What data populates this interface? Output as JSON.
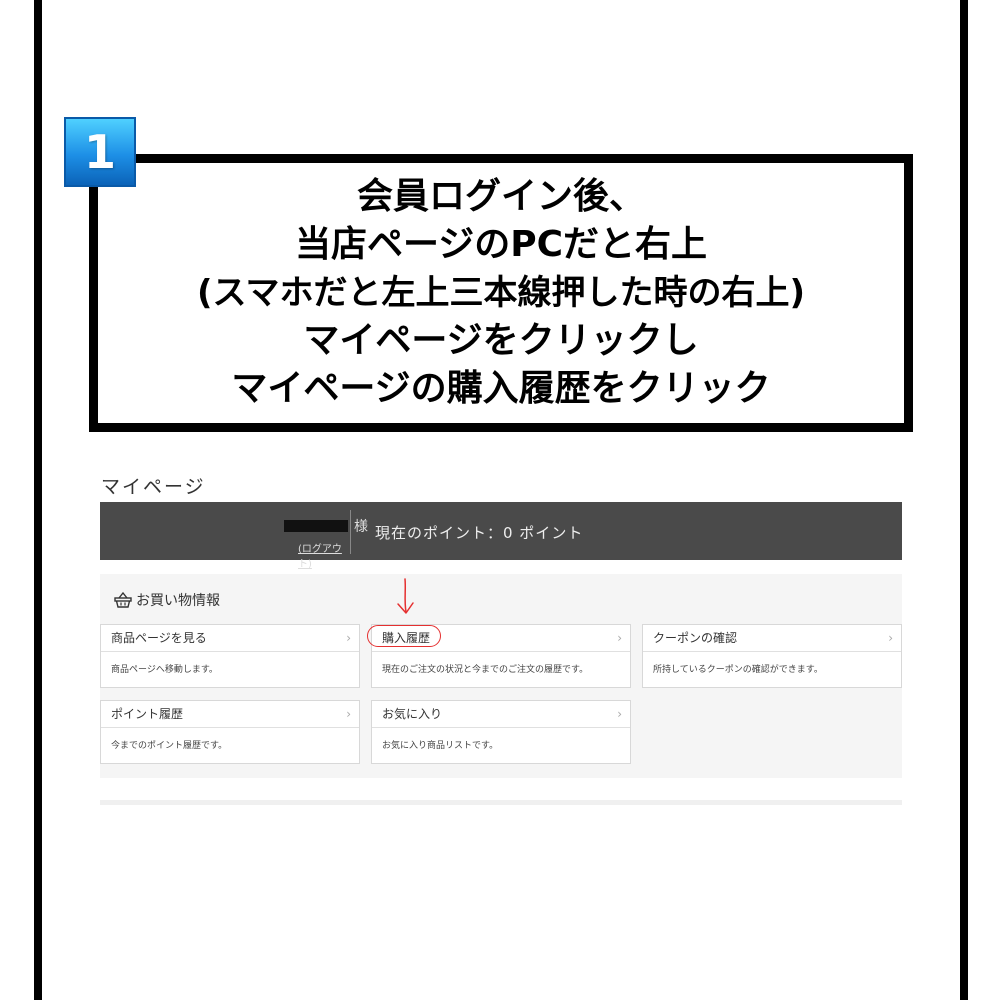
{
  "step": {
    "number": "1"
  },
  "instruction": {
    "lines": [
      "会員ログイン後、",
      "当店ページのPCだと右上",
      "(スマホだと左上三本線押した時の右上)",
      "マイページをクリックし",
      "マイページの購入履歴をクリック"
    ]
  },
  "mypage": {
    "heading": "マイページ",
    "member": {
      "honorific": "様",
      "logout_label": "(ログアウト)",
      "points_text": "現在のポイント：0 ポイント"
    },
    "shopping": {
      "section_title": "お買い物情報",
      "section_icon": "basket-icon",
      "cards": [
        {
          "title": "商品ページを見る",
          "desc": "商品ページへ移動します。"
        },
        {
          "title": "購入履歴",
          "desc": "現在のご注文の状況と今までのご注文の履歴です。"
        },
        {
          "title": "クーポンの確認",
          "desc": "所持しているクーポンの確認ができます。"
        },
        {
          "title": "ポイント履歴",
          "desc": "今までのポイント履歴です。"
        },
        {
          "title": "お気に入り",
          "desc": "お気に入り商品リストです。"
        }
      ],
      "chevron": "›"
    }
  },
  "colors": {
    "member_bar": "#4a4a4a",
    "annotation_red": "#e53030",
    "badge_blue": "#1d8fe6"
  }
}
